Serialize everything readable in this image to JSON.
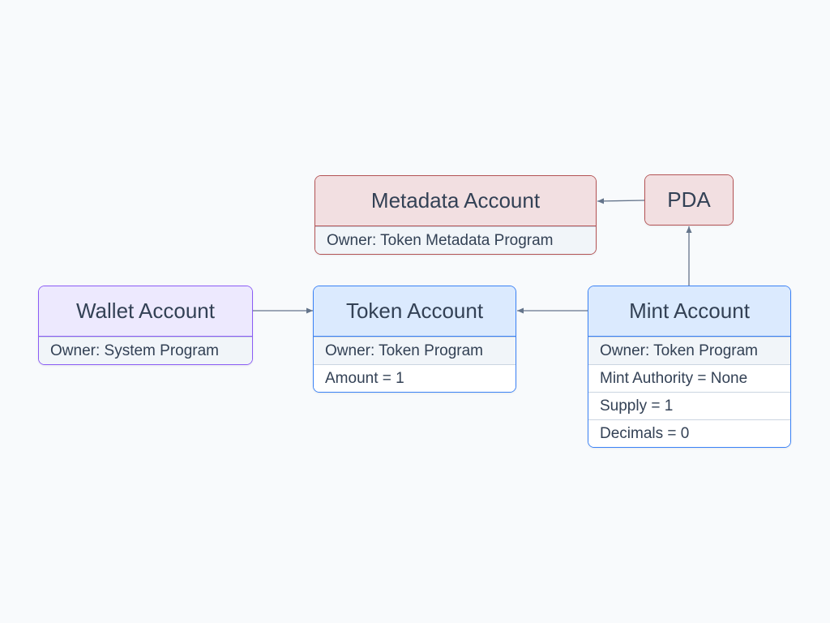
{
  "colors": {
    "background": "#f8fafc",
    "text": "#334155",
    "edge": "#64748b",
    "wallet_border": "#8b5cf6",
    "wallet_fill": "#ede9fe",
    "account_border": "#3b82f6",
    "account_fill": "#dbeafe",
    "metadata_border": "#b45355",
    "metadata_fill": "#f2dfe1"
  },
  "nodes": {
    "wallet": {
      "title": "Wallet Account",
      "rows": [
        "Owner: System Program"
      ]
    },
    "token": {
      "title": "Token Account",
      "rows": [
        "Owner: Token Program",
        "Amount = 1"
      ]
    },
    "mint": {
      "title": "Mint Account",
      "rows": [
        "Owner: Token Program",
        "Mint Authority = None",
        "Supply = 1",
        "Decimals = 0"
      ]
    },
    "metadata": {
      "title": "Metadata Account",
      "rows": [
        "Owner: Token Metadata Program"
      ]
    },
    "pda": {
      "title": "PDA"
    }
  },
  "edges": [
    {
      "from": "wallet",
      "to": "token"
    },
    {
      "from": "mint",
      "to": "token"
    },
    {
      "from": "mint",
      "to": "pda"
    },
    {
      "from": "pda",
      "to": "metadata"
    }
  ]
}
